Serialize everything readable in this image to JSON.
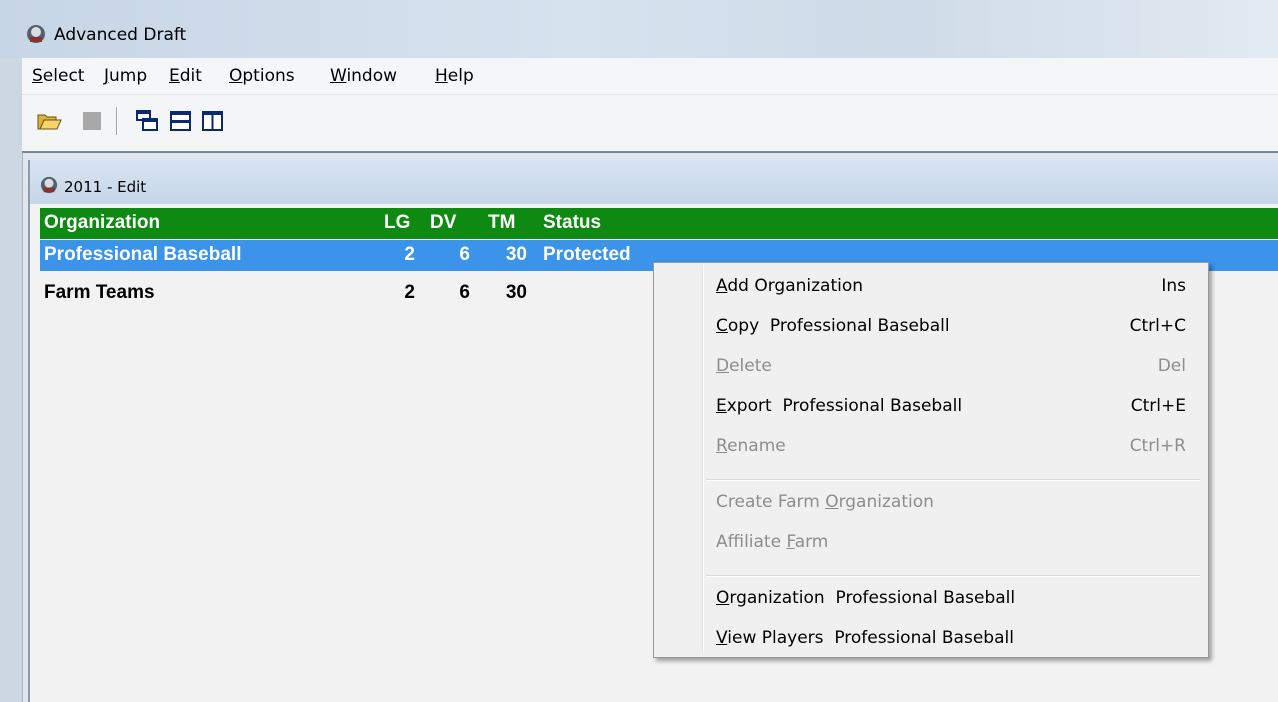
{
  "window": {
    "title": "Advanced Draft",
    "app_icon": "baseball-player-icon"
  },
  "menubar": {
    "items": [
      {
        "label": "Select",
        "mnemonic": "S"
      },
      {
        "label": "Jump",
        "mnemonic": "J"
      },
      {
        "label": "Edit",
        "mnemonic": "E"
      },
      {
        "label": "Options",
        "mnemonic": "O"
      },
      {
        "label": "Window",
        "mnemonic": "W"
      },
      {
        "label": "Help",
        "mnemonic": "H"
      }
    ]
  },
  "toolbar": {
    "buttons": [
      {
        "icon": "open-folder-icon"
      },
      {
        "icon": "stop-icon"
      },
      {
        "icon": "cascade-windows-icon"
      },
      {
        "icon": "tile-horizontal-icon"
      },
      {
        "icon": "tile-vertical-icon"
      }
    ]
  },
  "child_window": {
    "title": "2011 - Edit",
    "columns": {
      "organization": "Organization",
      "lg": "LG",
      "dv": "DV",
      "tm": "TM",
      "status": "Status"
    },
    "rows": [
      {
        "organization": "Professional Baseball",
        "lg": "2",
        "dv": "6",
        "tm": "30",
        "status": "Protected",
        "selected": true
      },
      {
        "organization": "Farm Teams",
        "lg": "2",
        "dv": "6",
        "tm": "30",
        "status": "",
        "selected": false
      }
    ]
  },
  "context_menu": {
    "groups": [
      [
        {
          "label": "Add Organization",
          "mnemonic": "A",
          "shortcut": "Ins",
          "enabled": true
        },
        {
          "label": "Copy  Professional Baseball",
          "mnemonic": "C",
          "shortcut": "Ctrl+C",
          "enabled": true
        },
        {
          "label": "Delete",
          "mnemonic": "D",
          "shortcut": "Del",
          "enabled": false
        },
        {
          "label": "Export  Professional Baseball",
          "mnemonic": "E",
          "shortcut": "Ctrl+E",
          "enabled": true
        },
        {
          "label": "Rename",
          "mnemonic": "R",
          "shortcut": "Ctrl+R",
          "enabled": false
        }
      ],
      [
        {
          "label": "Create Farm Organization",
          "mnemonic": "O",
          "shortcut": "",
          "enabled": false
        },
        {
          "label": "Affiliate Farm",
          "mnemonic": "F",
          "shortcut": "",
          "enabled": false
        }
      ],
      [
        {
          "label": "Organization  Professional Baseball",
          "mnemonic": "O",
          "shortcut": "",
          "enabled": true
        },
        {
          "label": "View Players  Professional Baseball",
          "mnemonic": "V",
          "shortcut": "",
          "enabled": true
        }
      ]
    ]
  },
  "colors": {
    "header_green": "#0e8a12",
    "selection_blue": "#3b94ea",
    "disabled_text": "#8d8d8d"
  }
}
